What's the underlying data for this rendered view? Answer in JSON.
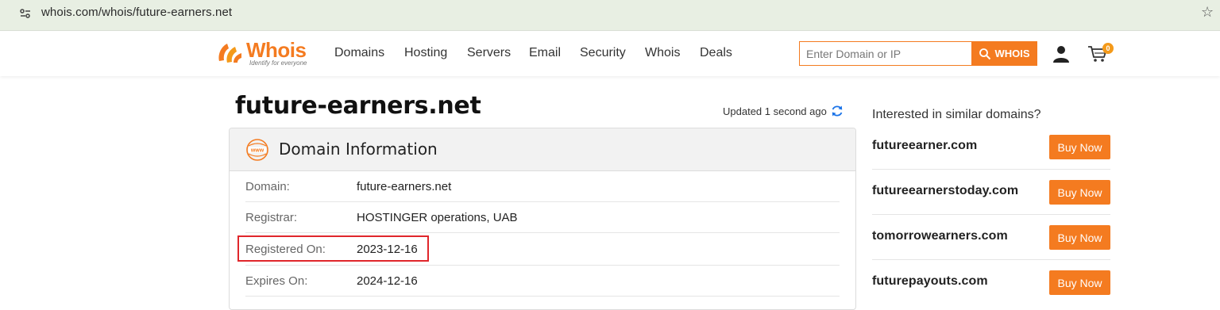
{
  "browser": {
    "url": "whois.com/whois/future-earners.net"
  },
  "header": {
    "logo_text": "Whois",
    "logo_tagline": "Identify for everyone",
    "nav": [
      "Domains",
      "Hosting",
      "Servers",
      "Email",
      "Security",
      "Whois",
      "Deals"
    ],
    "search_placeholder": "Enter Domain or IP",
    "search_button": "WHOIS",
    "cart_count": "0",
    "accent_color": "#f47b20"
  },
  "main": {
    "title": "future-earners.net",
    "updated": "Updated 1 second ago",
    "panel_title": "Domain Information",
    "rows": [
      {
        "label": "Domain:",
        "value": "future-earners.net"
      },
      {
        "label": "Registrar:",
        "value": "HOSTINGER operations, UAB"
      },
      {
        "label": "Registered On:",
        "value": "2023-12-16"
      },
      {
        "label": "Expires On:",
        "value": "2024-12-16"
      }
    ]
  },
  "sidebar": {
    "title": "Interested in similar domains?",
    "domains": [
      {
        "name": "futureearner.com",
        "button": "Buy Now"
      },
      {
        "name": "futureearnerstoday.com",
        "button": "Buy Now"
      },
      {
        "name": "tomorrowearners.com",
        "button": "Buy Now"
      },
      {
        "name": "futurepayouts.com",
        "button": "Buy Now"
      }
    ]
  }
}
